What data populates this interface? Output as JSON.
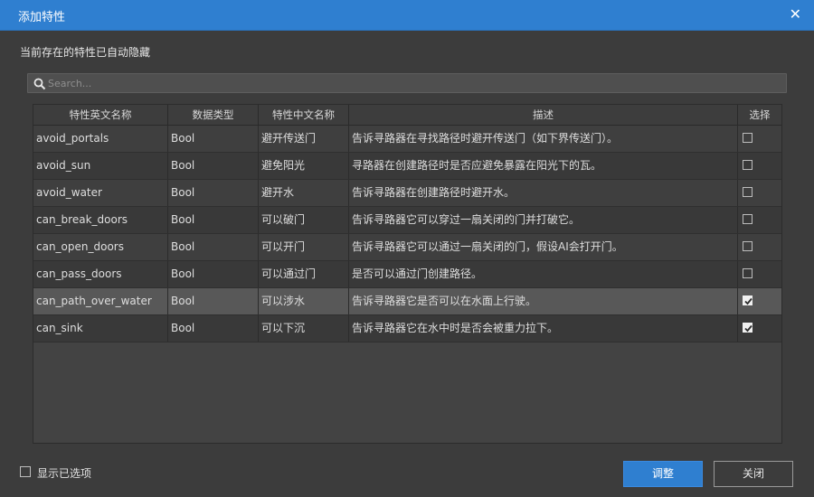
{
  "window": {
    "title": "添加特性",
    "close_glyph": "✕"
  },
  "subtitle": "当前存在的特性已自动隐藏",
  "search": {
    "placeholder": "Search..."
  },
  "table": {
    "headers": [
      "特性英文名称",
      "数据类型",
      "特性中文名称",
      "描述",
      "选择"
    ],
    "rows": [
      {
        "en": "avoid_portals",
        "type": "Bool",
        "cn": "避开传送门",
        "desc": "告诉寻路器在寻找路径时避开传送门（如下界传送门）。",
        "checked": false
      },
      {
        "en": "avoid_sun",
        "type": "Bool",
        "cn": "避免阳光",
        "desc": "寻路器在创建路径时是否应避免暴露在阳光下的瓦。",
        "checked": false
      },
      {
        "en": "avoid_water",
        "type": "Bool",
        "cn": "避开水",
        "desc": "告诉寻路器在创建路径时避开水。",
        "checked": false
      },
      {
        "en": "can_break_doors",
        "type": "Bool",
        "cn": "可以破门",
        "desc": "告诉寻路器它可以穿过一扇关闭的门并打破它。",
        "checked": false
      },
      {
        "en": "can_open_doors",
        "type": "Bool",
        "cn": "可以开门",
        "desc": "告诉寻路器它可以通过一扇关闭的门，假设AI会打开门。",
        "checked": false
      },
      {
        "en": "can_pass_doors",
        "type": "Bool",
        "cn": "可以通过门",
        "desc": "是否可以通过门创建路径。",
        "checked": false
      },
      {
        "en": "can_path_over_water",
        "type": "Bool",
        "cn": "可以涉水",
        "desc": "告诉寻路器它是否可以在水面上行驶。",
        "checked": true,
        "selected": true
      },
      {
        "en": "can_sink",
        "type": "Bool",
        "cn": "可以下沉",
        "desc": "告诉寻路器它在水中时是否会被重力拉下。",
        "checked": true
      }
    ]
  },
  "footer": {
    "show_selected_label": "显示已选项",
    "adjust_label": "调整",
    "close_label": "关闭"
  },
  "colors": {
    "accent": "#2f7fd0",
    "background": "#3c3c3c"
  }
}
